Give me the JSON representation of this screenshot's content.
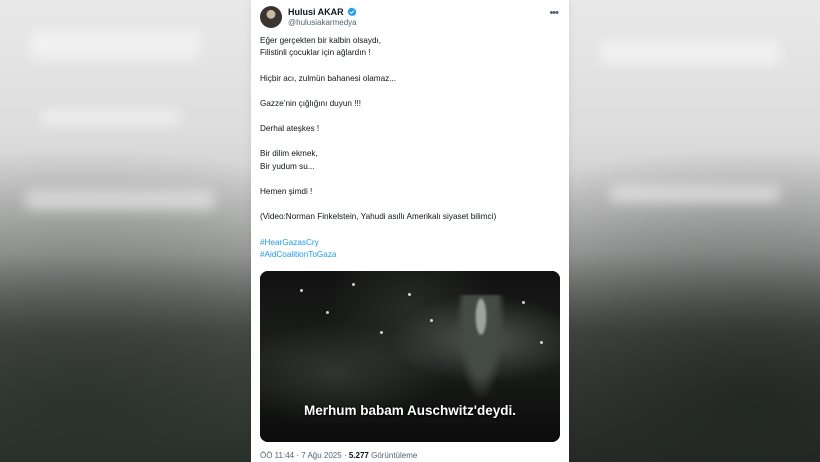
{
  "tweet": {
    "display_name": "Hulusi AKAR",
    "handle": "@hulusiakarmedya",
    "verified_icon": "verified-badge-icon",
    "more_icon": "more-options-icon",
    "colors": {
      "accent": "#1d9bf0",
      "text": "#0f1419",
      "muted": "#536471"
    },
    "lines": [
      "Eğer gerçekten bir kalbin olsaydı,",
      "Filistinli çocuklar için ağlardın !",
      "Hiçbir acı, zulmün bahanesi olamaz...",
      "Gazze’nin çığlığını duyun !!!",
      "Derhal ateşkes !",
      "Bir dilim ekmek,",
      "Bir yudum su...",
      "Hemen şimdi !",
      "(Video:Norman Finkelstein, Yahudi asıllı Amerikalı siyaset bilimci)"
    ],
    "hashtags": [
      "#HearGazasCry",
      "#AidCoalitionToGaza"
    ],
    "video_subtitle": "Merhum babam Auschwitz'deydi.",
    "meta": {
      "time": "ÖÖ 11:44",
      "date": "7 Ağu 2025",
      "views": "5.277",
      "views_label": "Görüntüleme"
    }
  }
}
